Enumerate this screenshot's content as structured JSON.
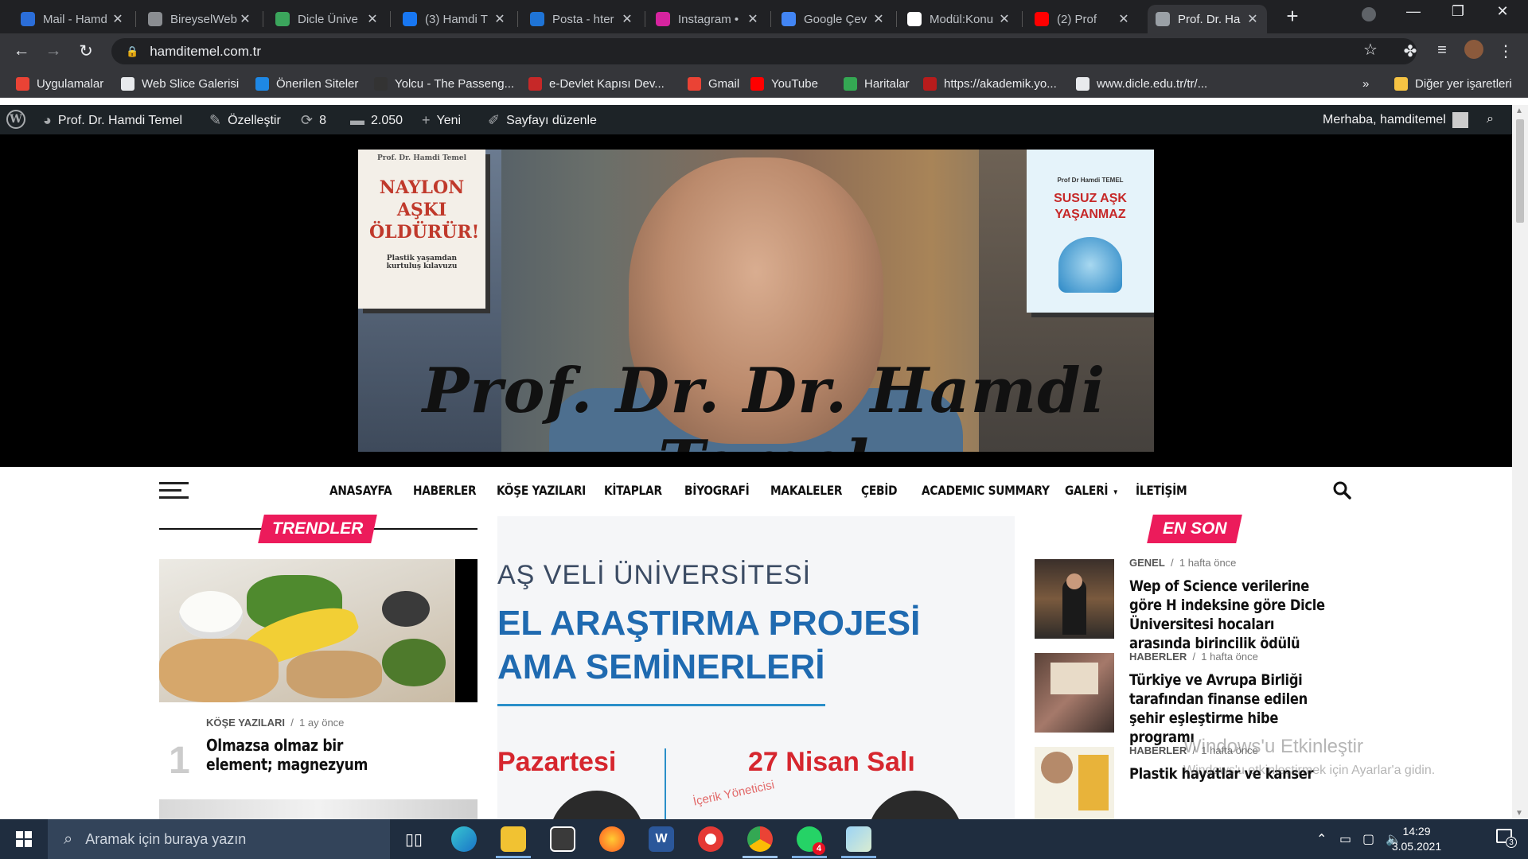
{
  "tabs": [
    {
      "title": "Mail - Hamd",
      "color": "#2b6ed9"
    },
    {
      "title": "BireyselWeb",
      "color": "#8a8d91"
    },
    {
      "title": "Dicle Ünive",
      "color": "#3ba55c"
    },
    {
      "title": "(3) Hamdi T",
      "color": "#1877f2"
    },
    {
      "title": "Posta - hter",
      "color": "#1f74d6"
    },
    {
      "title": "Instagram •",
      "color": "#d6249f"
    },
    {
      "title": "Google Çev",
      "color": "#4285f4"
    },
    {
      "title": "Modül:Konu",
      "color": "#ffffff"
    },
    {
      "title": "(2) Prof",
      "color": "#ff0000"
    },
    {
      "title": "Prof. Dr. Ha",
      "color": "#9aa0a6"
    }
  ],
  "tab_close_glyph": "✕",
  "new_tab_glyph": "+",
  "window_controls": [
    "—",
    "❐",
    "✕"
  ],
  "address": {
    "url": "hamditemel.com.tr"
  },
  "bookmarks": [
    {
      "label": "Uygulamalar",
      "color": "#ea4335"
    },
    {
      "label": "Web Slice Galerisi",
      "color": "#e8eaed"
    },
    {
      "label": "Önerilen Siteler",
      "color": "#1e88e5"
    },
    {
      "label": "Yolcu - The Passeng...",
      "color": "#333333"
    },
    {
      "label": "e-Devlet Kapısı Dev...",
      "color": "#c62828"
    },
    {
      "label": "Gmail",
      "color": "#ea4335"
    },
    {
      "label": "YouTube",
      "color": "#ff0000"
    },
    {
      "label": "Haritalar",
      "color": "#34a853"
    },
    {
      "label": "https://akademik.yo...",
      "color": "#b71c1c"
    },
    {
      "label": "www.dicle.edu.tr/tr/...",
      "color": "#e8eaed"
    }
  ],
  "bookmarks_more": "»",
  "bookmarks_other": "Diğer yer işaretleri",
  "wpbar": {
    "site_name": "Prof. Dr. Hamdi Temel",
    "customize": "Özelleştir",
    "updates": "8",
    "comments": "2.050",
    "new": "Yeni",
    "edit_page": "Sayfayı düzenle",
    "greeting": "Merhaba, hamditemel"
  },
  "banner": {
    "signature": "Prof. Dr. Dr. Hamdi Temel",
    "book_left": {
      "author": "Prof. Dr. Hamdi Temel",
      "title": "NAYLON AŞKI ÖLDÜRÜR!",
      "subtitle": "Plastik yaşamdan kurtuluş kılavuzu"
    },
    "book_right": {
      "author": "Prof Dr Hamdi TEMEL",
      "title": "SUSUZ AŞK YAŞANMAZ"
    }
  },
  "nav": [
    "ANASAYFA",
    "HABERLER",
    "KÖŞE YAZILARI",
    "KİTAPLAR",
    "BİYOGRAFİ",
    "MAKALELER",
    "ÇEBİD",
    "ACADEMIC SUMMARY",
    "GALERİ",
    "İLETİŞİM"
  ],
  "nav_dropdown": "▾",
  "trends": {
    "label": "TRENDLER",
    "item": {
      "num": "1",
      "category": "KÖŞE YAZILARI",
      "time": "1 ay önce",
      "title": "Olmazsa olmaz bir element; magnezyum"
    }
  },
  "feature": {
    "line1": "AŞ VELİ ÜNİVERSİTESİ",
    "line2": "EL ARAŞTIRMA PROJESİ",
    "line3": "AMA SEMİNERLERİ",
    "day1": "Pazartesi",
    "day2": "27 Nisan Salı",
    "stamp": "İçerik Yöneticisi"
  },
  "latest": {
    "label": "EN SON",
    "items": [
      {
        "category": "GENEL",
        "time": "1 hafta önce",
        "title": "Wep of Science verilerine göre H indeksine göre Dicle Üniversitesi hocaları arasında birincilik ödülü"
      },
      {
        "category": "HABERLER",
        "time": "1 hafta önce",
        "title": "Türkiye ve Avrupa Birliği tarafından finanse edilen şehir eşleştirme hibe programı"
      },
      {
        "category": "HABERLER",
        "time": "1 hafta önce",
        "title": "Plastik hayatlar ve kanser"
      }
    ]
  },
  "watermark": {
    "title": "Windows'u Etkinleştir",
    "subtitle": "Windows'u etkinleştirmek için Ayarlar'a gidin."
  },
  "taskbar": {
    "search_placeholder": "Aramak için buraya yazın",
    "time": "14:29",
    "date": "3.05.2021",
    "notification_count": "3",
    "whatsapp_badge": "4"
  }
}
